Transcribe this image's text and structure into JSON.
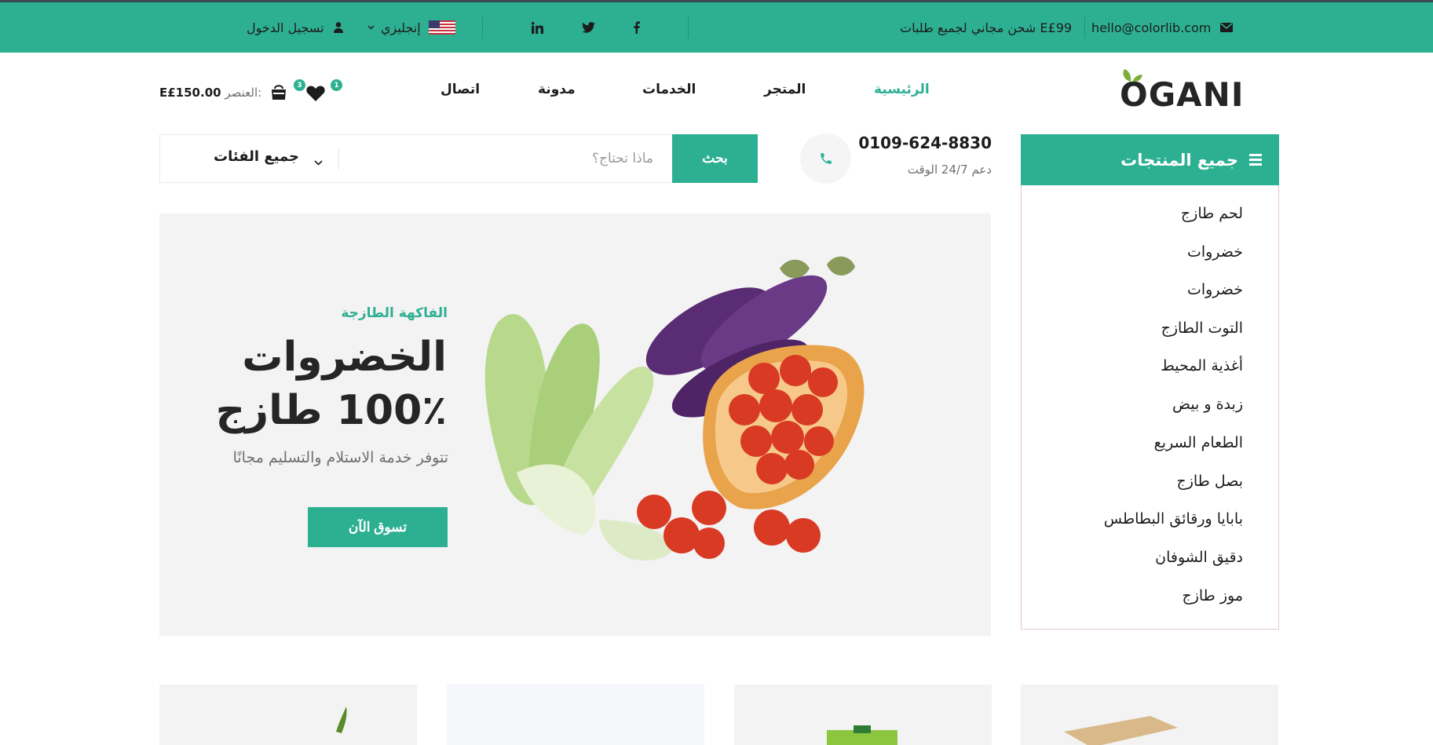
{
  "topbar": {
    "email": "hello@colorlib.com",
    "shipping": "شحن مجاني لجميع طلبات E£99",
    "language": "إنجليزي",
    "login": "تسجيل الدخول",
    "social": [
      "facebook-icon",
      "twitter-icon",
      "linkedin-icon"
    ]
  },
  "header": {
    "logo": "OGANI",
    "nav": [
      "الرئيسية",
      "المتجر",
      "الخدمات",
      "مدونة",
      "اتصال"
    ],
    "wishlist_count": "1",
    "cart_count": "3",
    "cart_label": "العنصر:",
    "cart_total": "E£150.00"
  },
  "categories": {
    "title": "جميع المنتجات",
    "items": [
      "لحم طازج",
      "خضروات",
      "خضروات",
      "التوت الطازج",
      "أغذية المحيط",
      "زبدة و بيض",
      "الطعام السريع",
      "بصل طازج",
      "بابايا ورقائق البطاطس",
      "دقيق الشوفان",
      "موز طازج"
    ]
  },
  "search": {
    "all_categories": "جميع الفئات",
    "placeholder": "ماذا تحتاج؟",
    "button": "بحث"
  },
  "contact": {
    "phone": "0109-624-8830",
    "support": "دعم 24/7 الوقت"
  },
  "hero": {
    "kicker": "الفاكهة الطازجة",
    "title_line1": "الخضروات",
    "title_line2": "100٪ طازج",
    "subtitle": "تتوفر خدمة الاستلام والتسليم مجانًا",
    "button": "تسوق الآن"
  },
  "colors": {
    "accent": "#2db092",
    "text": "#1c1c1c",
    "muted": "#6f6f6f"
  }
}
